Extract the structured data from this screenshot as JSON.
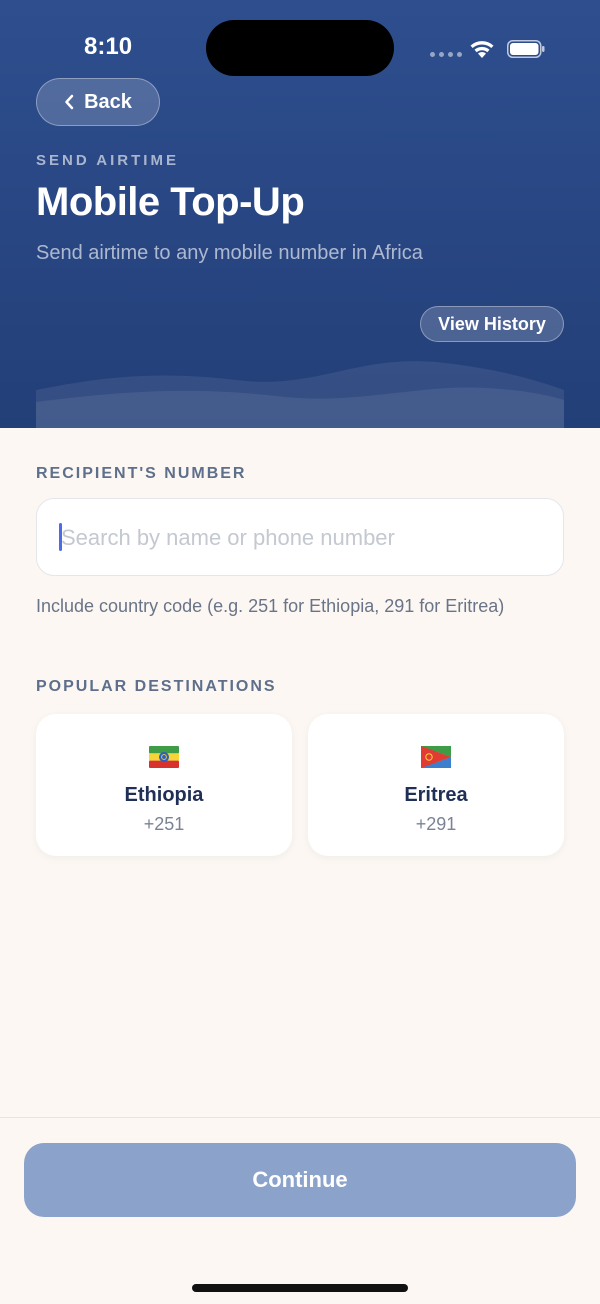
{
  "status_bar": {
    "time": "8:10"
  },
  "header": {
    "back_label": "Back",
    "eyebrow": "SEND AIRTIME",
    "title": "Mobile Top-Up",
    "subtitle": "Send airtime to any mobile number in Africa",
    "history_label": "View History"
  },
  "recipient": {
    "label": "RECIPIENT'S NUMBER",
    "placeholder": "Search by name or phone number",
    "value": "",
    "hint": "Include country code (e.g. 251 for Ethiopia, 291 for Eritrea)"
  },
  "destinations": {
    "label": "POPULAR DESTINATIONS",
    "items": [
      {
        "name": "Ethiopia",
        "code": "+251",
        "flag": "ethiopia-flag-icon"
      },
      {
        "name": "Eritrea",
        "code": "+291",
        "flag": "eritrea-flag-icon"
      }
    ]
  },
  "footer": {
    "continue_label": "Continue",
    "continue_disabled": true
  },
  "colors": {
    "header": "#2E4E8E",
    "background": "#FCF7F2",
    "button_disabled": "#8BA3CB",
    "accent": "#3B5BDB"
  }
}
